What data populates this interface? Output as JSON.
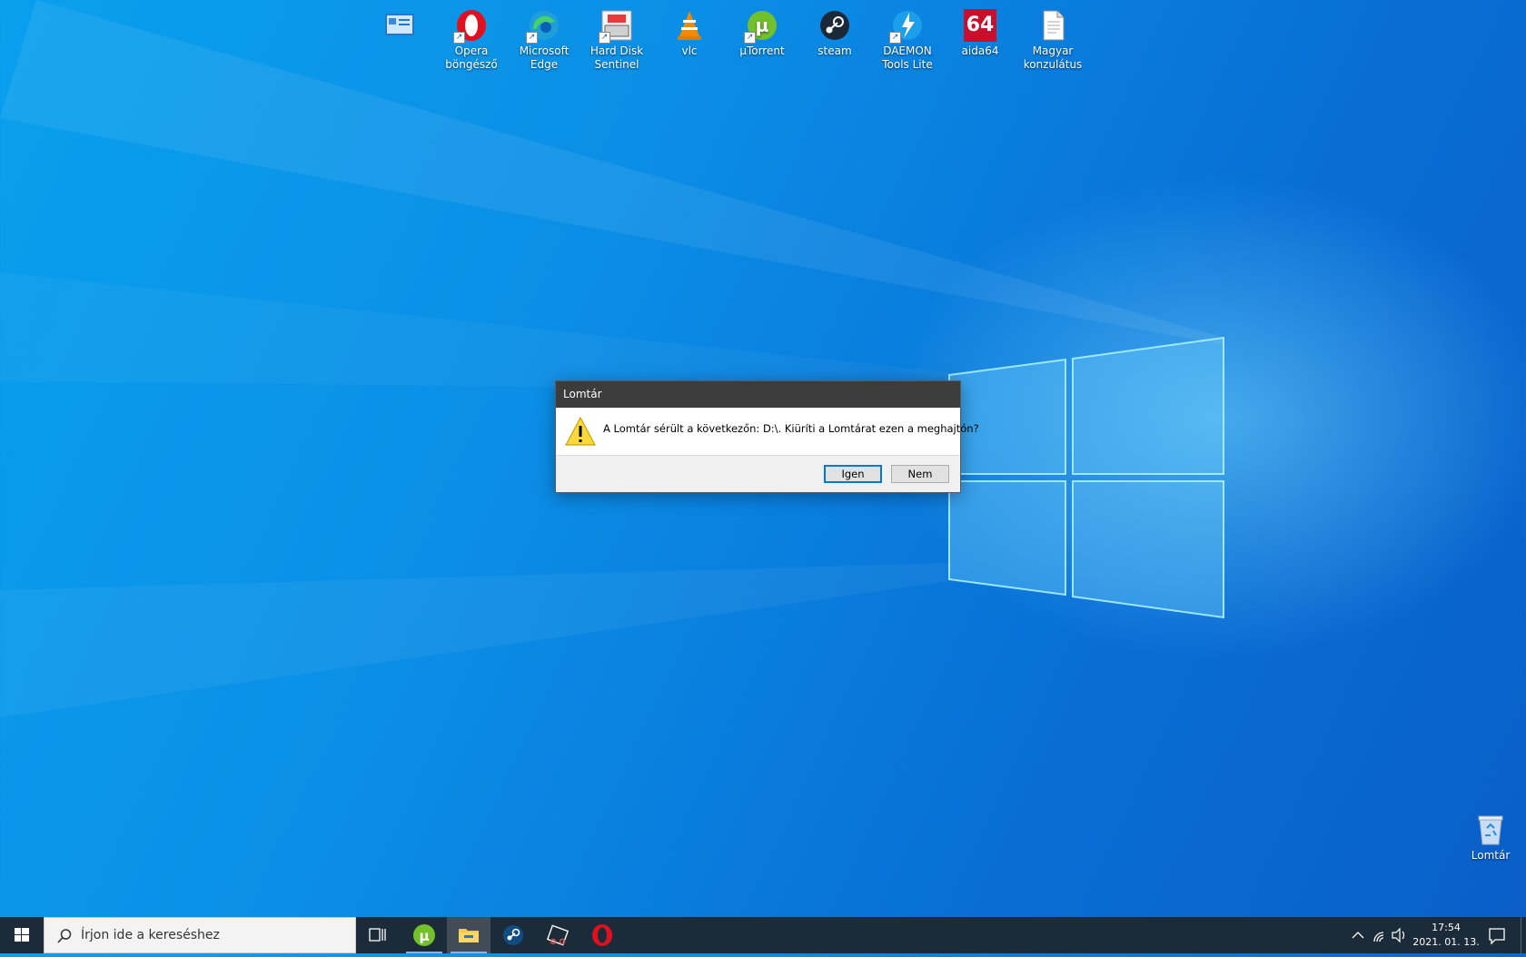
{
  "desktop": {
    "icons": [
      {
        "label": "",
        "icon": "control-panel-icon"
      },
      {
        "label": "Opera böngésző",
        "icon": "opera-icon"
      },
      {
        "label": "Microsoft Edge",
        "icon": "edge-icon"
      },
      {
        "label": "Hard Disk Sentinel",
        "icon": "hdsentinel-icon"
      },
      {
        "label": "vlc",
        "icon": "vlc-icon"
      },
      {
        "label": "µTorrent",
        "icon": "utorrent-icon"
      },
      {
        "label": "steam",
        "icon": "steam-icon"
      },
      {
        "label": "DAEMON Tools Lite",
        "icon": "daemon-tools-icon"
      },
      {
        "label": "aida64",
        "icon": "aida64-icon",
        "badge": "64"
      },
      {
        "label": "Magyar konzulátus",
        "icon": "document-icon"
      }
    ],
    "recycle_bin": {
      "label": "Lomtár",
      "icon": "recycle-bin-icon"
    }
  },
  "dialog": {
    "title": "Lomtár",
    "message": "A Lomtár sérült a következőn: D:\\. Kiüríti a Lomtárat ezen a meghajtón?",
    "yes_label": "Igen",
    "no_label": "Nem",
    "icon": "warning-icon"
  },
  "taskbar": {
    "search_placeholder": "Írjon ide a kereséshez",
    "apps": [
      "task-view-icon",
      "utorrent-icon",
      "file-explorer-icon",
      "steam-icon",
      "snipping-tool-icon",
      "opera-icon"
    ],
    "clock_time": "17:54",
    "clock_date": "2021. 01. 13.",
    "accent": "#0078d7"
  }
}
